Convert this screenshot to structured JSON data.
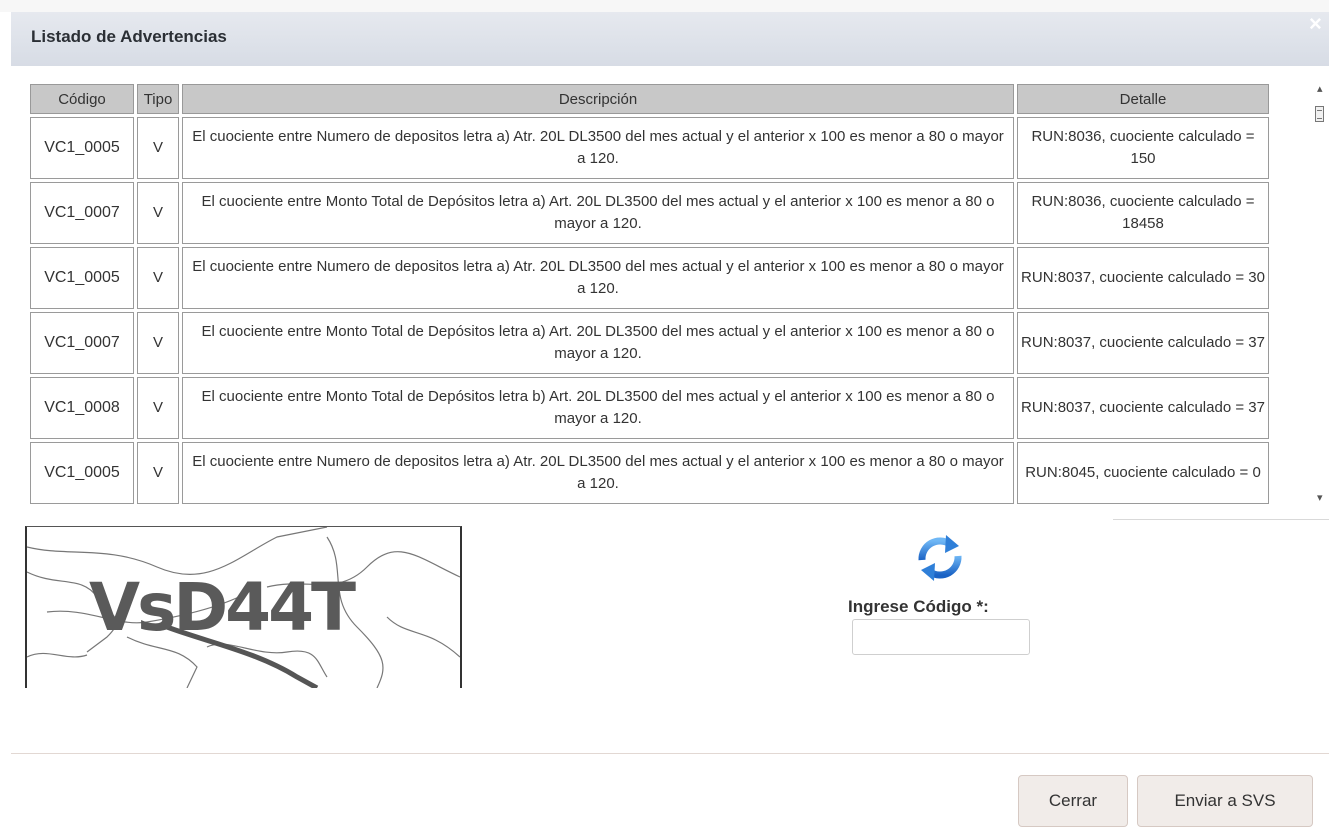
{
  "dialog": {
    "title": "Listado de Advertencias",
    "close_label": "×"
  },
  "table": {
    "headers": [
      "Código",
      "Tipo",
      "Descripción",
      "Detalle"
    ],
    "rows": [
      {
        "codigo": "VC1_0005",
        "tipo": "V",
        "descripcion": "El cuociente entre Numero de depositos letra a) Atr. 20L DL3500 del mes actual y el anterior x 100 es menor a 80 o mayor a 120.",
        "detalle": "RUN:8036, cuociente calculado = 150"
      },
      {
        "codigo": "VC1_0007",
        "tipo": "V",
        "descripcion": "El cuociente entre Monto Total de Depósitos letra a) Art. 20L DL3500 del mes actual y el anterior x 100 es menor a 80 o mayor a 120.",
        "detalle": "RUN:8036, cuociente calculado = 18458"
      },
      {
        "codigo": "VC1_0005",
        "tipo": "V",
        "descripcion": "El cuociente entre Numero de depositos letra a) Atr. 20L DL3500 del mes actual y el anterior x 100 es menor a 80 o mayor a 120.",
        "detalle": "RUN:8037, cuociente calculado = 30"
      },
      {
        "codigo": "VC1_0007",
        "tipo": "V",
        "descripcion": "El cuociente entre Monto Total de Depósitos letra a) Art. 20L DL3500 del mes actual y el anterior x 100 es menor a 80 o mayor a 120.",
        "detalle": "RUN:8037, cuociente calculado = 37"
      },
      {
        "codigo": "VC1_0008",
        "tipo": "V",
        "descripcion": "El cuociente entre Monto Total de Depósitos letra b) Art. 20L DL3500 del mes actual y el anterior x 100 es menor a 80 o mayor a 120.",
        "detalle": "RUN:8037, cuociente calculado = 37"
      },
      {
        "codigo": "VC1_0005",
        "tipo": "V",
        "descripcion": "El cuociente entre Numero de depositos letra a) Atr. 20L DL3500 del mes actual y el anterior x 100 es menor a 80 o mayor a 120.",
        "detalle": "RUN:8045, cuociente calculado = 0"
      }
    ]
  },
  "captcha": {
    "image_text": "VsD44T",
    "code_label": "Ingrese Código *:",
    "code_value": "",
    "refresh_icon": "refresh-icon"
  },
  "buttons": {
    "close": "Cerrar",
    "send": "Enviar a SVS"
  },
  "colors": {
    "titlebar": "#dde1e8",
    "header_cell": "#c8c8c8",
    "button_bg": "#f1ece9",
    "refresh_blue": "#2f7fd8"
  }
}
